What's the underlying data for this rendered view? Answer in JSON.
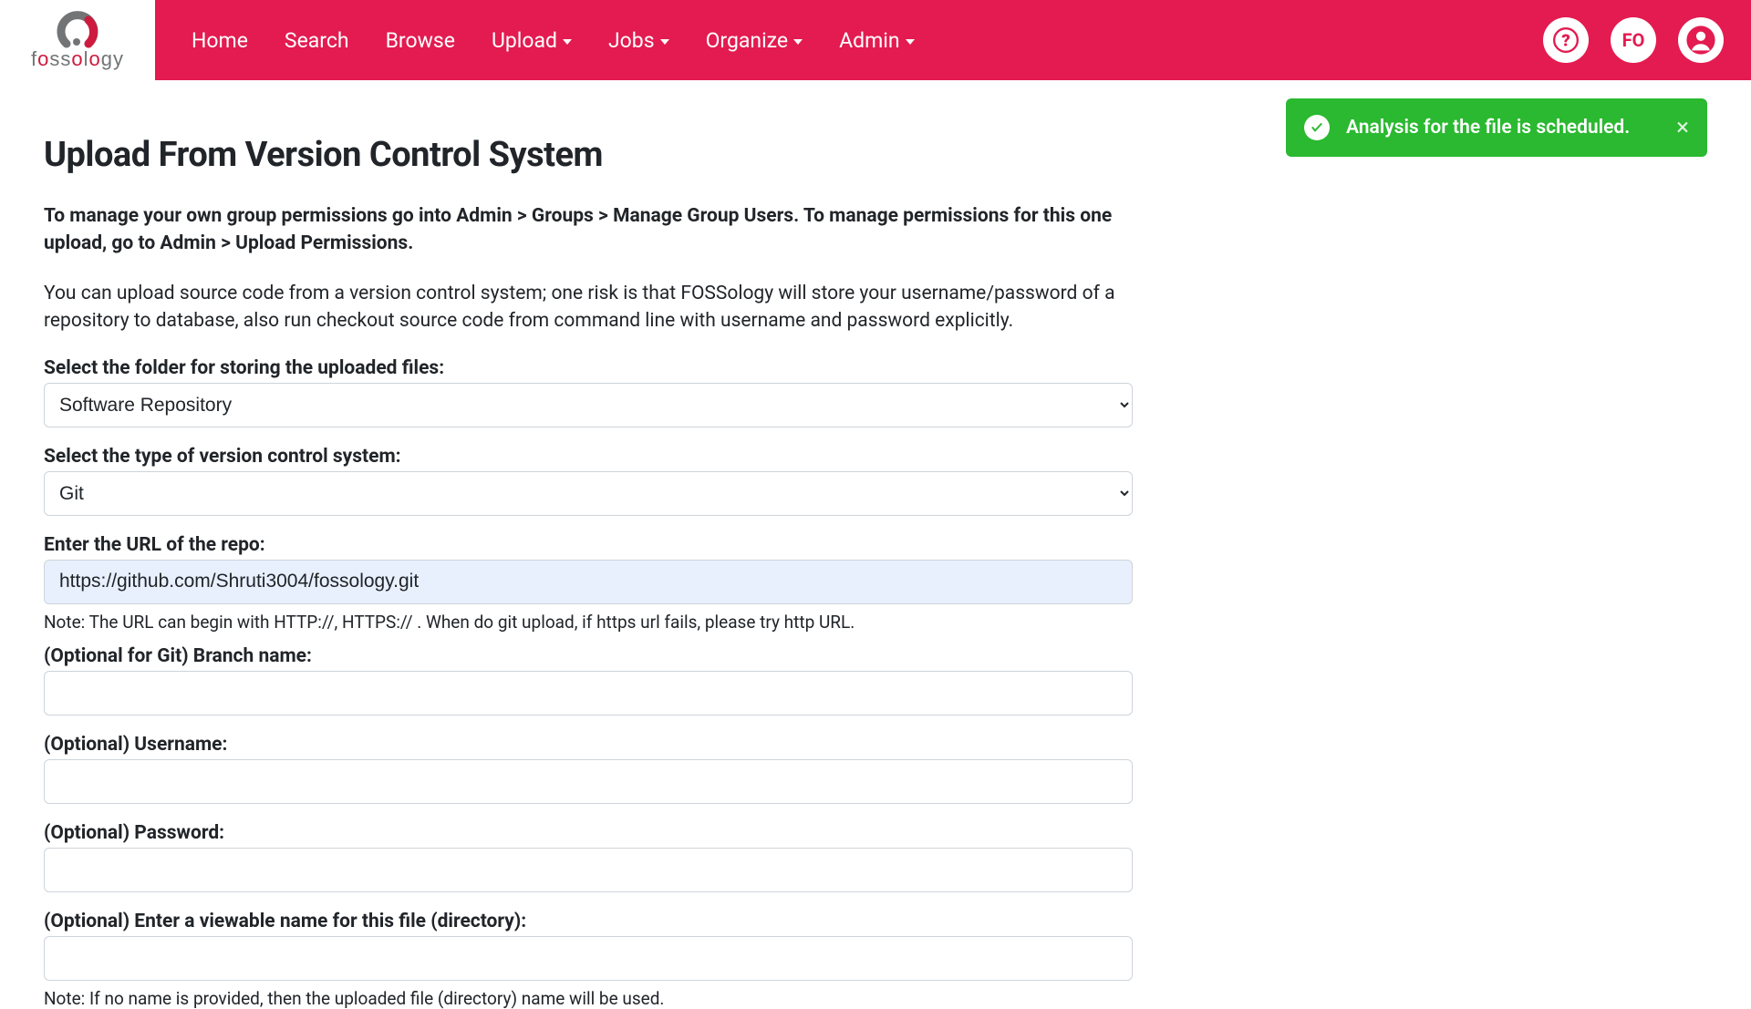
{
  "nav": {
    "home": "Home",
    "search": "Search",
    "browse": "Browse",
    "upload": "Upload",
    "jobs": "Jobs",
    "organize": "Organize",
    "admin": "Admin",
    "fo_badge": "FO"
  },
  "toast": {
    "message": "Analysis for the file is scheduled.",
    "close": "×"
  },
  "page": {
    "title": "Upload From Version Control System",
    "para1": "To manage your own group permissions go into Admin > Groups > Manage Group Users. To manage permissions for this one upload, go to Admin > Upload Permissions.",
    "para2": "You can upload source code from a version control system; one risk is that FOSSology will store your username/password of a repository to database, also run checkout source code from command line with username and password explicitly."
  },
  "form": {
    "folder_label": "Select the folder for storing the uploaded files:",
    "folder_value": "Software Repository",
    "vcs_label": "Select the type of version control system:",
    "vcs_value": "Git",
    "url_label": "Enter the URL of the repo:",
    "url_value": "https://github.com/Shruti3004/fossology.git",
    "url_note": "Note: The URL can begin with HTTP://, HTTPS:// . When do git upload, if https url fails, please try http URL.",
    "branch_label": "(Optional for Git) Branch name:",
    "branch_value": "",
    "username_label": "(Optional) Username:",
    "username_value": "",
    "password_label": "(Optional) Password:",
    "password_value": "",
    "viewname_label": "(Optional) Enter a viewable name for this file (directory):",
    "viewname_value": "",
    "viewname_note": "Note: If no name is provided, then the uploaded file (directory) name will be used."
  }
}
